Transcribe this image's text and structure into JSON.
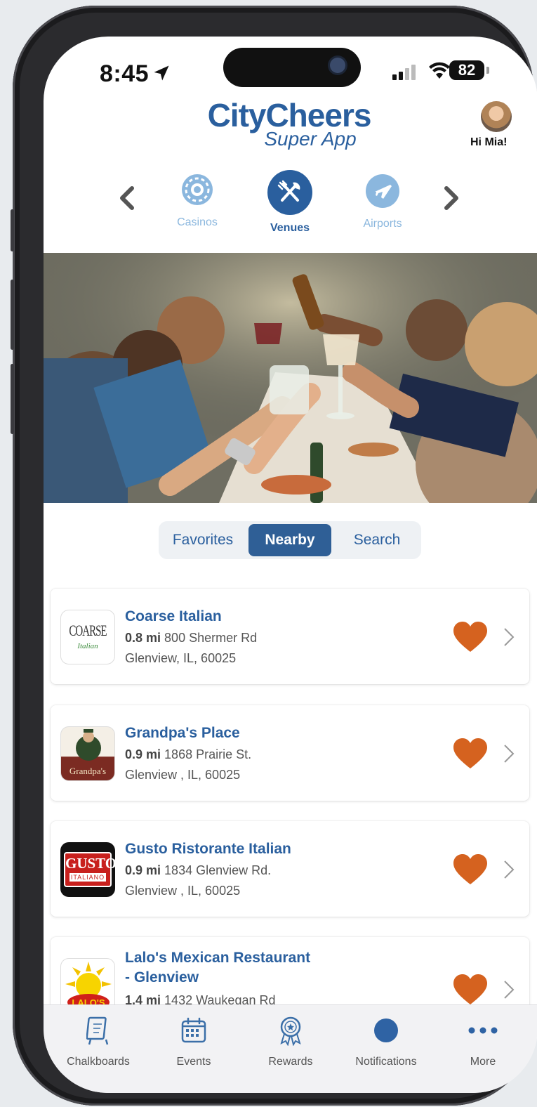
{
  "status_bar": {
    "time": "8:45",
    "battery": "82"
  },
  "header": {
    "logo_main": "CityCheers",
    "logo_sub": "Super App",
    "greeting": "Hi Mia!"
  },
  "categories": [
    {
      "label": "Casinos",
      "icon": "casino-chip-icon",
      "active": false
    },
    {
      "label": "Venues",
      "icon": "fork-knife-icon",
      "active": true
    },
    {
      "label": "Airports",
      "icon": "airplane-icon",
      "active": false
    }
  ],
  "segmented": {
    "tabs": [
      "Favorites",
      "Nearby",
      "Search"
    ],
    "active": "Nearby"
  },
  "venues": [
    {
      "name": "Coarse Italian",
      "distance": "0.8 mi",
      "street": "800 Shermer Rd",
      "city": "Glenview, IL, 60025",
      "logo_text": "COARSE",
      "logo_sub": "Italian"
    },
    {
      "name": "Grandpa's Place",
      "distance": "0.9 mi",
      "street": "1868 Prairie St.",
      "city": "Glenview , IL, 60025",
      "logo_text": "Grandpa's"
    },
    {
      "name": "Gusto Ristorante Italian",
      "distance": "0.9 mi",
      "street": "1834 Glenview Rd.",
      "city": "Glenview , IL, 60025",
      "logo_text": "GUSTO",
      "logo_sub": "ITALIANO"
    },
    {
      "name": "Lalo's Mexican Restaurant",
      "name2": "- Glenview",
      "distance": "1.4 mi",
      "street": "1432 Waukegan Rd",
      "logo_text": "LALO'S"
    }
  ],
  "tabbar": [
    {
      "label": "Chalkboards",
      "icon": "chalkboard-icon"
    },
    {
      "label": "Events",
      "icon": "calendar-icon"
    },
    {
      "label": "Rewards",
      "icon": "award-ribbon-icon"
    },
    {
      "label": "Notifications",
      "icon": "notification-dot-icon"
    },
    {
      "label": "More",
      "icon": "more-dots-icon"
    }
  ],
  "colors": {
    "brand_blue": "#2a5f9e",
    "heart": "#d5621f",
    "light_blue": "#8bb7de"
  }
}
